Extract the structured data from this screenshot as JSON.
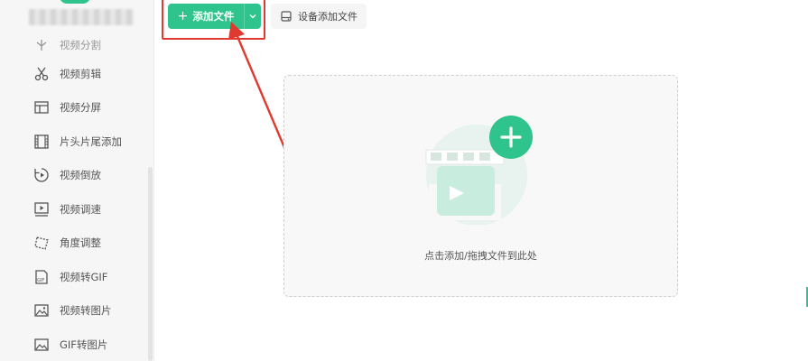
{
  "toolbar": {
    "add_file_label": "添加文件",
    "add_file_plus": "+",
    "device_add_label": "设备添加文件"
  },
  "sidebar": {
    "items": [
      {
        "label": "视频分割",
        "icon": "split-icon"
      },
      {
        "label": "视频剪辑",
        "icon": "scissors-icon"
      },
      {
        "label": "视频分屏",
        "icon": "split-screen-icon"
      },
      {
        "label": "片头片尾添加",
        "icon": "film-icon"
      },
      {
        "label": "视频倒放",
        "icon": "reverse-icon"
      },
      {
        "label": "视频调速",
        "icon": "speed-icon"
      },
      {
        "label": "角度调整",
        "icon": "rotate-icon"
      },
      {
        "label": "视频转GIF",
        "icon": "gif-icon"
      },
      {
        "label": "视频转图片",
        "icon": "image-icon"
      },
      {
        "label": "GIF转图片",
        "icon": "gif-image-icon"
      }
    ]
  },
  "dropzone": {
    "hint": "点击添加/拖拽文件到此处"
  },
  "colors": {
    "accent": "#2fc38d",
    "annotation": "#e0392f"
  }
}
